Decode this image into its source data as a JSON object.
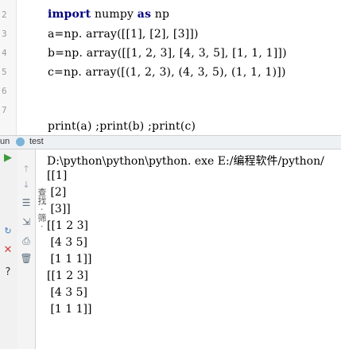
{
  "editor": {
    "line_numbers": [
      "2",
      "3",
      "4",
      "5",
      "6",
      "7"
    ],
    "lines": [
      {
        "kw": "import",
        "rest": " numpy ",
        "kw2": "as",
        "rest2": " np"
      },
      {
        "text": "a=np. array([[1], [2], [3]])"
      },
      {
        "text": "b=np. array([[1, 2, 3], [4, 3, 5], [1, 1, 1]])"
      },
      {
        "text": "c=np. array([(1, 2, 3), (4, 3, 5), (1, 1, 1)])"
      },
      {
        "text": ""
      },
      {
        "text": "print(a) ;print(b) ;print(c)"
      }
    ]
  },
  "run_bar": {
    "prefix": "un",
    "config": "test"
  },
  "console": {
    "lines": [
      "D:\\python\\python\\python. exe E:/编程软件/python/",
      "[[1]",
      " [2]",
      " [3]]",
      "[[1 2 3]",
      " [4 3 5]",
      " [1 1 1]]",
      "[[1 2 3]",
      " [4 3 5]",
      " [1 1 1]]"
    ]
  },
  "toolbar": {
    "side_icons": [
      "run-icon",
      "rerun-icon",
      "stop-icon",
      "close-icon",
      "help-icon"
    ],
    "inner_icons": [
      "up-arrow-icon",
      "down-arrow-icon",
      "wrap-icon",
      "scroll-end-icon",
      "print-icon",
      "trash-icon"
    ]
  },
  "vertical_tab": "查找 · 筛 ·"
}
